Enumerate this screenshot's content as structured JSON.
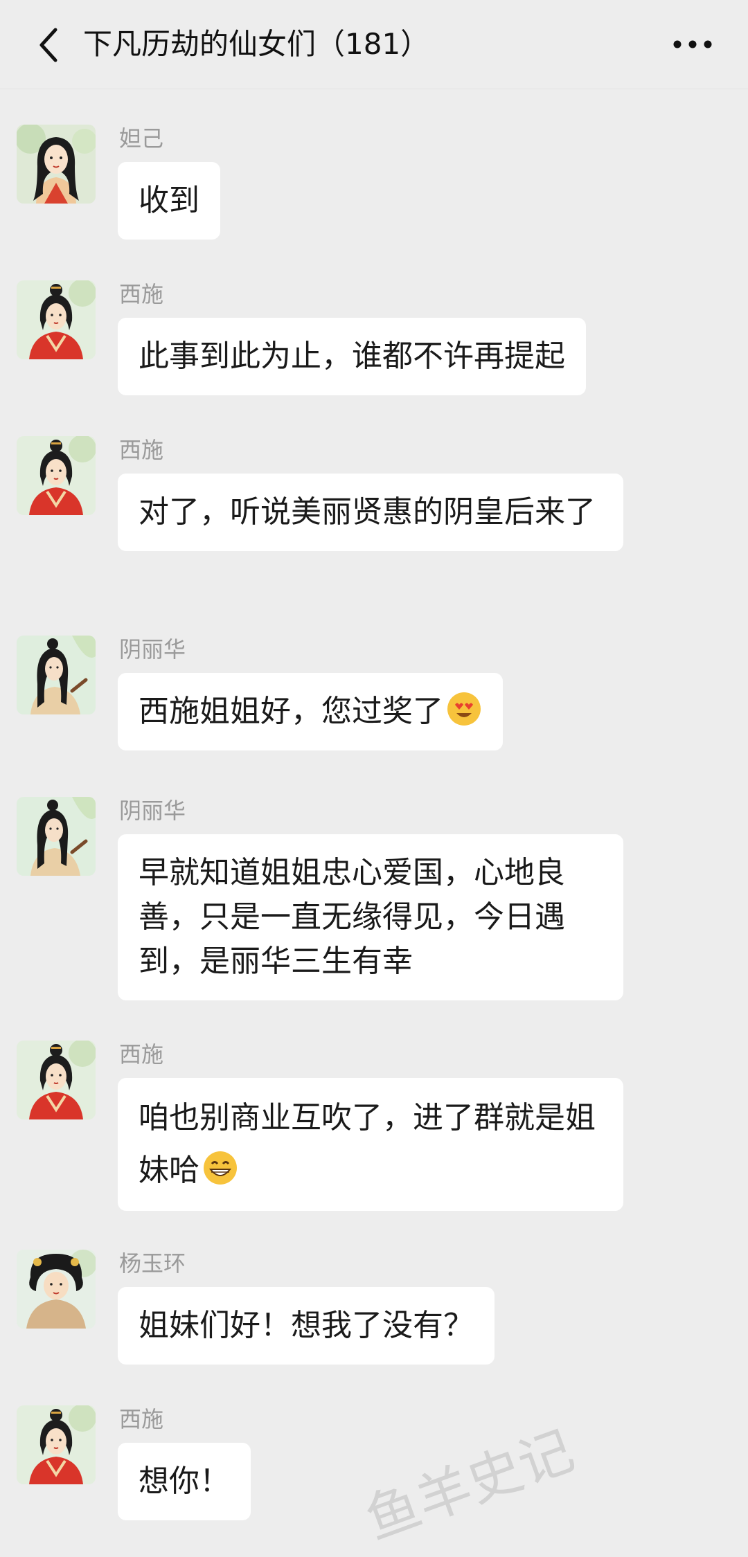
{
  "header": {
    "title": "下凡历劫的仙女们（181）",
    "back_icon": "chevron-left-icon",
    "more_icon": "more-horizontal-icon"
  },
  "messages": [
    {
      "sender": "妲己",
      "text": "收到",
      "emoji": "",
      "avatar": "daji"
    },
    {
      "sender": "西施",
      "text": "此事到此为止，谁都不许再提起",
      "emoji": "",
      "avatar": "xishi"
    },
    {
      "sender": "西施",
      "text": "对了，听说美丽贤惠的阴皇后来了",
      "emoji": "",
      "avatar": "xishi"
    },
    {
      "sender": "阴丽华",
      "text": "西施姐姐好，您过奖了",
      "emoji": "heart-eyes-emoji",
      "avatar": "yinlihua"
    },
    {
      "sender": "阴丽华",
      "text": "早就知道姐姐忠心爱国，心地良善，只是一直无缘得见，今日遇到，是丽华三生有幸",
      "emoji": "",
      "avatar": "yinlihua"
    },
    {
      "sender": "西施",
      "text": "咱也别商业互吹了，进了群就是姐妹哈",
      "emoji": "grin-emoji",
      "avatar": "xishi"
    },
    {
      "sender": "杨玉环",
      "text": "姐妹们好！想我了没有？",
      "emoji": "",
      "avatar": "yangyuhuan"
    },
    {
      "sender": "西施",
      "text": "想你！",
      "emoji": "",
      "avatar": "xishi"
    }
  ],
  "watermark": "鱼羊史记",
  "colors": {
    "background": "#ededed",
    "bubble": "#ffffff",
    "sender_name": "#9a9a9a",
    "text": "#1a1a1a"
  }
}
